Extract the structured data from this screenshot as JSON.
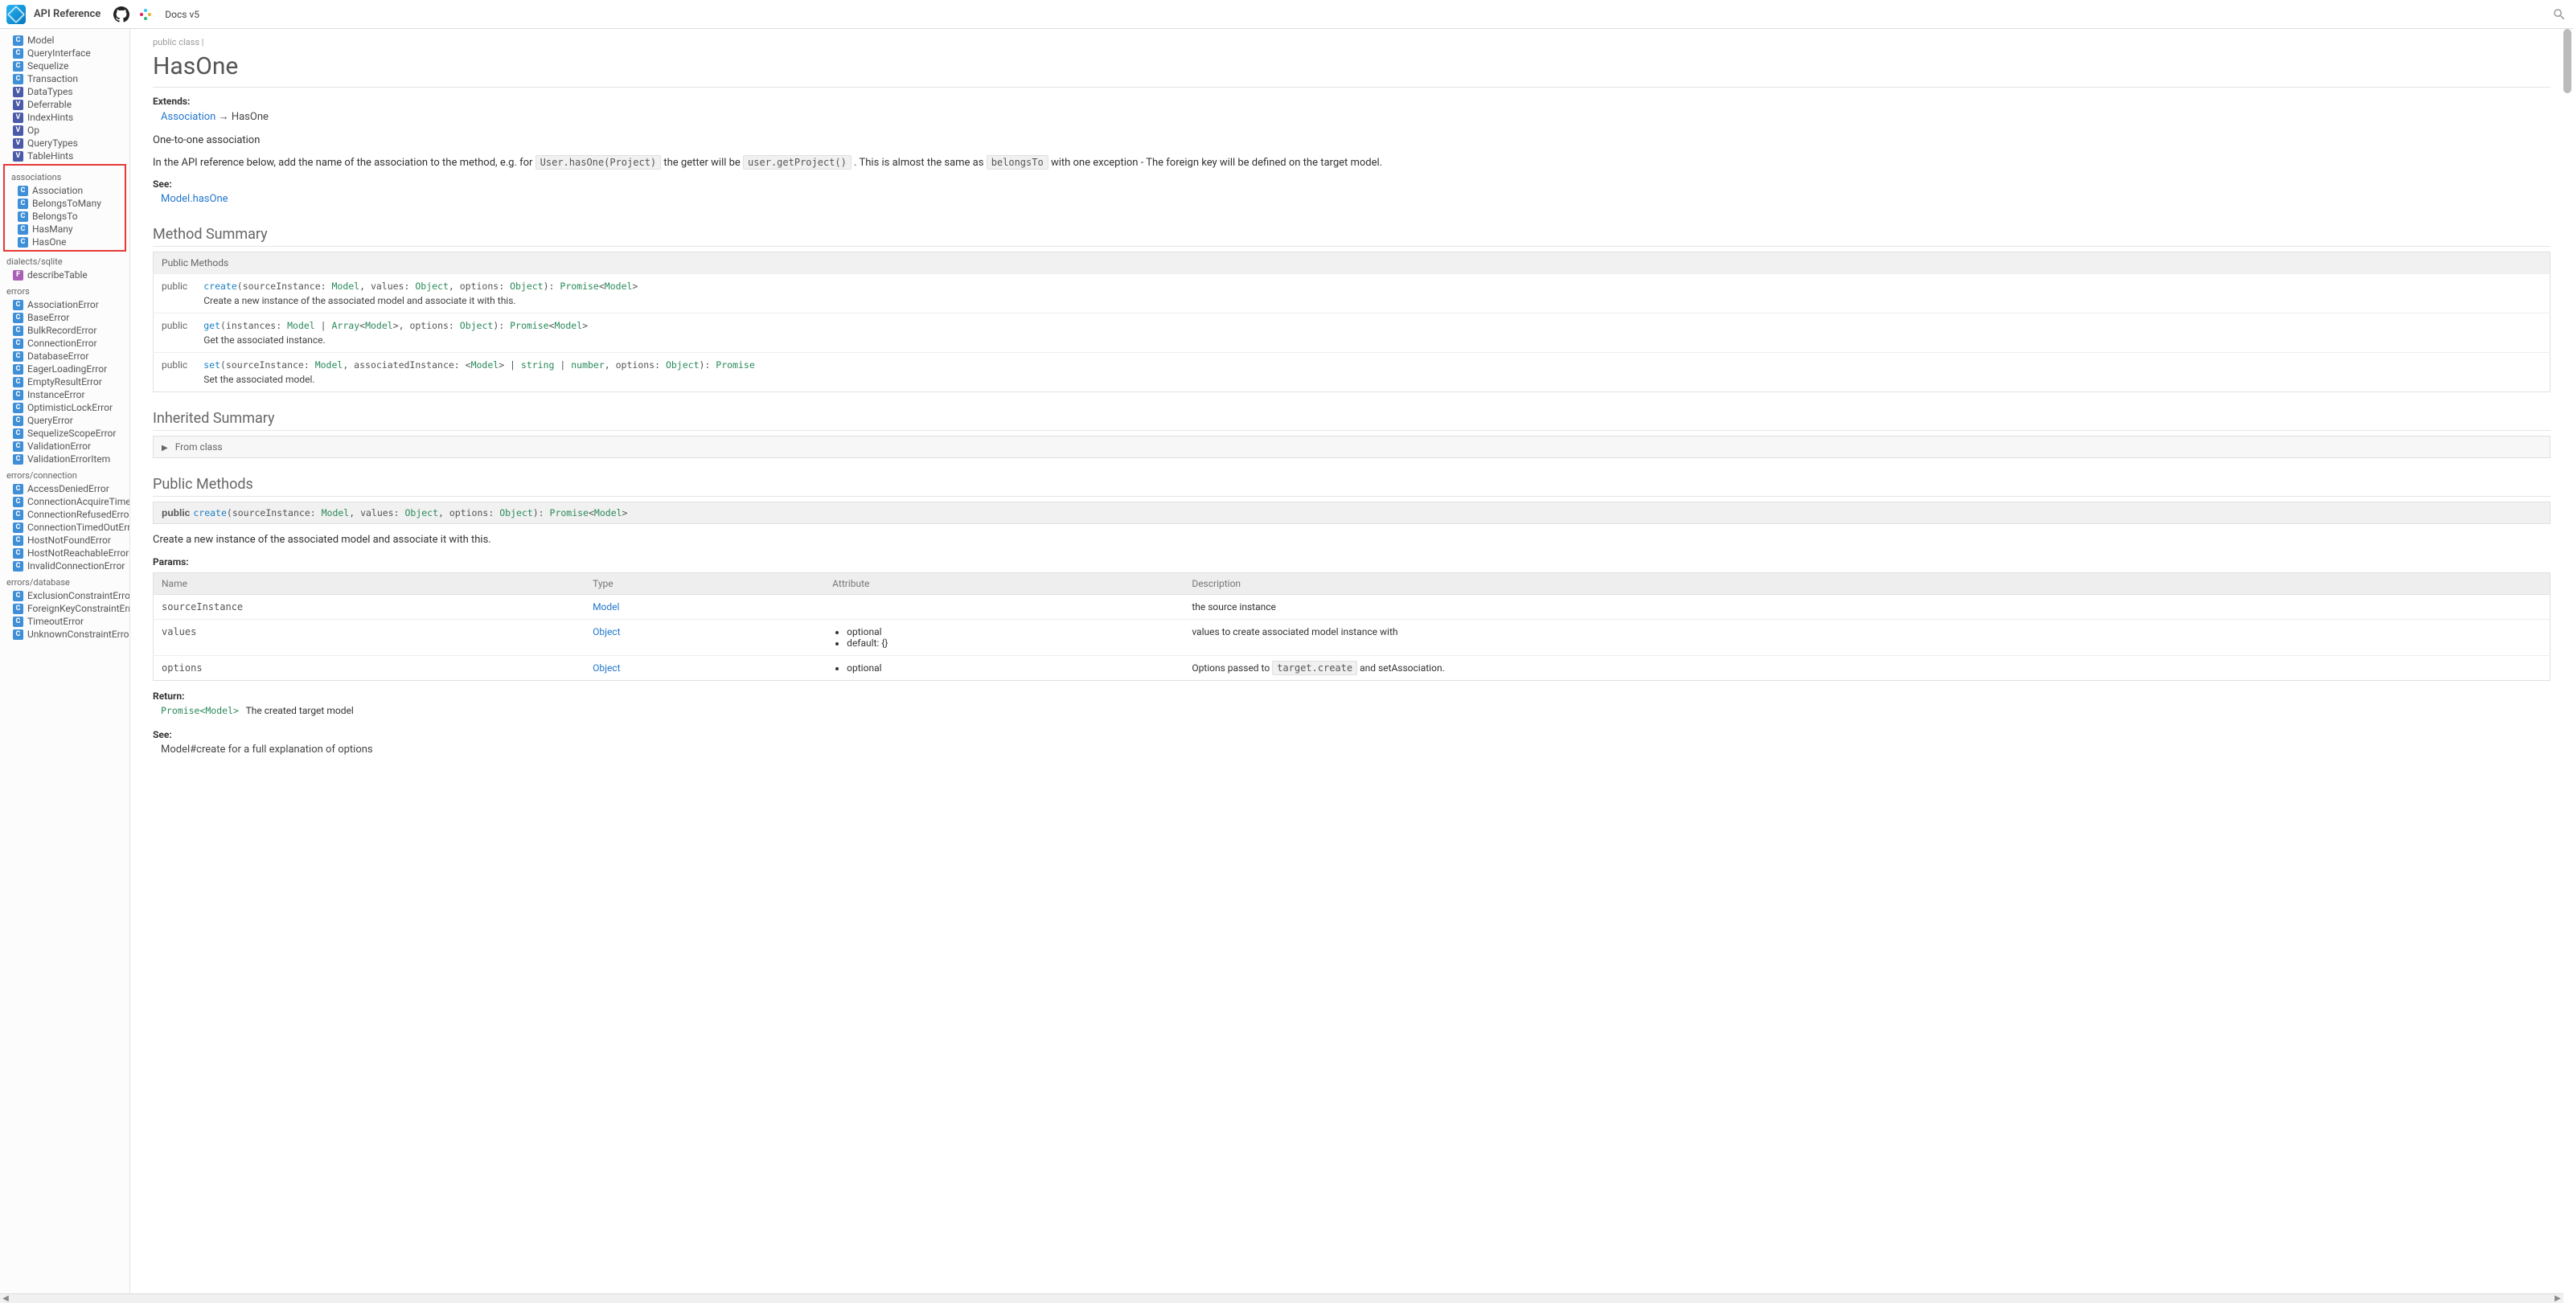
{
  "header": {
    "title": "API Reference",
    "docsVersion": "Docs v5"
  },
  "sidebar": {
    "top": [
      {
        "b": "C",
        "t": "Model"
      },
      {
        "b": "C",
        "t": "QueryInterface"
      },
      {
        "b": "C",
        "t": "Sequelize"
      },
      {
        "b": "C",
        "t": "Transaction"
      },
      {
        "b": "V",
        "t": "DataTypes"
      },
      {
        "b": "V",
        "t": "Deferrable"
      },
      {
        "b": "V",
        "t": "IndexHints"
      },
      {
        "b": "V",
        "t": "Op"
      },
      {
        "b": "V",
        "t": "QueryTypes"
      },
      {
        "b": "V",
        "t": "TableHints"
      }
    ],
    "assocHeader": "associations",
    "assoc": [
      {
        "b": "C",
        "t": "Association"
      },
      {
        "b": "C",
        "t": "BelongsToMany"
      },
      {
        "b": "C",
        "t": "BelongsTo"
      },
      {
        "b": "C",
        "t": "HasMany"
      },
      {
        "b": "C",
        "t": "HasOne"
      }
    ],
    "dialectsHeader": "dialects/sqlite",
    "dialects": [
      {
        "b": "F",
        "t": "describeTable"
      }
    ],
    "errorsHeader": "errors",
    "errors": [
      {
        "b": "C",
        "t": "AssociationError"
      },
      {
        "b": "C",
        "t": "BaseError"
      },
      {
        "b": "C",
        "t": "BulkRecordError"
      },
      {
        "b": "C",
        "t": "ConnectionError"
      },
      {
        "b": "C",
        "t": "DatabaseError"
      },
      {
        "b": "C",
        "t": "EagerLoadingError"
      },
      {
        "b": "C",
        "t": "EmptyResultError"
      },
      {
        "b": "C",
        "t": "InstanceError"
      },
      {
        "b": "C",
        "t": "OptimisticLockError"
      },
      {
        "b": "C",
        "t": "QueryError"
      },
      {
        "b": "C",
        "t": "SequelizeScopeError"
      },
      {
        "b": "C",
        "t": "ValidationError"
      },
      {
        "b": "C",
        "t": "ValidationErrorItem"
      }
    ],
    "errConnHeader": "errors/connection",
    "errConn": [
      {
        "b": "C",
        "t": "AccessDeniedError"
      },
      {
        "b": "C",
        "t": "ConnectionAcquireTimeout"
      },
      {
        "b": "C",
        "t": "ConnectionRefusedError"
      },
      {
        "b": "C",
        "t": "ConnectionTimedOutError"
      },
      {
        "b": "C",
        "t": "HostNotFoundError"
      },
      {
        "b": "C",
        "t": "HostNotReachableError"
      },
      {
        "b": "C",
        "t": "InvalidConnectionError"
      }
    ],
    "errDbHeader": "errors/database",
    "errDb": [
      {
        "b": "C",
        "t": "ExclusionConstraintError"
      },
      {
        "b": "C",
        "t": "ForeignKeyConstraintError"
      },
      {
        "b": "C",
        "t": "TimeoutError"
      },
      {
        "b": "C",
        "t": "UnknownConstraintError"
      }
    ]
  },
  "page": {
    "crumb": "public class |",
    "title": "HasOne",
    "extendsLabel": "Extends:",
    "extendsLink": "Association",
    "extendsArrow": "→",
    "extendsTarget": "HasOne",
    "intro1": "One-to-one association",
    "intro2a": "In the API reference below, add the name of the association to the method, e.g. for ",
    "intro2code1": "User.hasOne(Project)",
    "intro2b": " the getter will be ",
    "intro2code2": "user.getProject()",
    "intro2c": " . This is almost the same as ",
    "intro2code3": "belongsTo",
    "intro2d": " with one exception - The foreign key will be defined on the target model.",
    "seeLabel": "See:",
    "seeLink": "Model.hasOne",
    "methodSummaryTitle": "Method Summary",
    "pubMethodsHeader": "Public Methods",
    "rows": [
      {
        "mod": "public",
        "sig": [
          [
            "fn",
            "create"
          ],
          [
            "punc",
            "(sourceInstance: "
          ],
          [
            "ty",
            "Model"
          ],
          [
            "punc",
            ", values: "
          ],
          [
            "ty",
            "Object"
          ],
          [
            "punc",
            ", options: "
          ],
          [
            "ty",
            "Object"
          ],
          [
            "punc",
            "): "
          ],
          [
            "ty",
            "Promise"
          ],
          [
            "punc",
            "<"
          ],
          [
            "ty",
            "Model"
          ],
          [
            "punc",
            ">"
          ]
        ],
        "desc": "Create a new instance of the associated model and associate it with this."
      },
      {
        "mod": "public",
        "sig": [
          [
            "fn",
            "get"
          ],
          [
            "punc",
            "(instances: "
          ],
          [
            "ty",
            "Model"
          ],
          [
            "punc",
            " | "
          ],
          [
            "ty",
            "Array"
          ],
          [
            "punc",
            "<"
          ],
          [
            "ty",
            "Model"
          ],
          [
            "punc",
            ">, options: "
          ],
          [
            "ty",
            "Object"
          ],
          [
            "punc",
            "): "
          ],
          [
            "ty",
            "Promise"
          ],
          [
            "punc",
            "<"
          ],
          [
            "ty",
            "Model"
          ],
          [
            "punc",
            ">"
          ]
        ],
        "desc": "Get the associated instance."
      },
      {
        "mod": "public",
        "sig": [
          [
            "fn",
            "set"
          ],
          [
            "punc",
            "(sourceInstance: "
          ],
          [
            "ty",
            "Model"
          ],
          [
            "punc",
            ", associatedInstance: <"
          ],
          [
            "ty",
            "Model"
          ],
          [
            "punc",
            "> | "
          ],
          [
            "ty",
            "string"
          ],
          [
            "punc",
            " | "
          ],
          [
            "ty",
            "number"
          ],
          [
            "punc",
            ", options: "
          ],
          [
            "ty",
            "Object"
          ],
          [
            "punc",
            "): "
          ],
          [
            "ty",
            "Promise"
          ]
        ],
        "desc": "Set the associated model."
      }
    ],
    "inheritedTitle": "Inherited Summary",
    "inheritedRow": "From class",
    "pubMethodsTitle": "Public Methods",
    "pubSig": {
      "mod": "public",
      "sig": [
        [
          "fn",
          "create"
        ],
        [
          "punc",
          "(sourceInstance: "
        ],
        [
          "ty",
          "Model"
        ],
        [
          "punc",
          ", values: "
        ],
        [
          "ty",
          "Object"
        ],
        [
          "punc",
          ", options: "
        ],
        [
          "ty",
          "Object"
        ],
        [
          "punc",
          "): "
        ],
        [
          "ty",
          "Promise"
        ],
        [
          "punc",
          "<"
        ],
        [
          "ty",
          "Model"
        ],
        [
          "punc",
          ">"
        ]
      ]
    },
    "pubDesc": "Create a new instance of the associated model and associate it with this.",
    "paramsLabel": "Params:",
    "paramsHead": [
      "Name",
      "Type",
      "Attribute",
      "Description"
    ],
    "params": [
      {
        "name": "sourceInstance",
        "type": "Model",
        "attrs": [],
        "desc": "the source instance"
      },
      {
        "name": "values",
        "type": "Object",
        "attrs": [
          "optional",
          "default: {}"
        ],
        "desc": "values to create associated model instance with"
      },
      {
        "name": "options",
        "type": "Object",
        "attrs": [
          "optional"
        ],
        "descPre": "Options passed to ",
        "descCode": "target.create",
        "descPost": " and setAssociation."
      }
    ],
    "returnLabel": "Return:",
    "returnType": "Promise<Model>",
    "returnDesc": "The created target model",
    "see2Label": "See:",
    "see2Text": "Model#create for a full explanation of options"
  }
}
